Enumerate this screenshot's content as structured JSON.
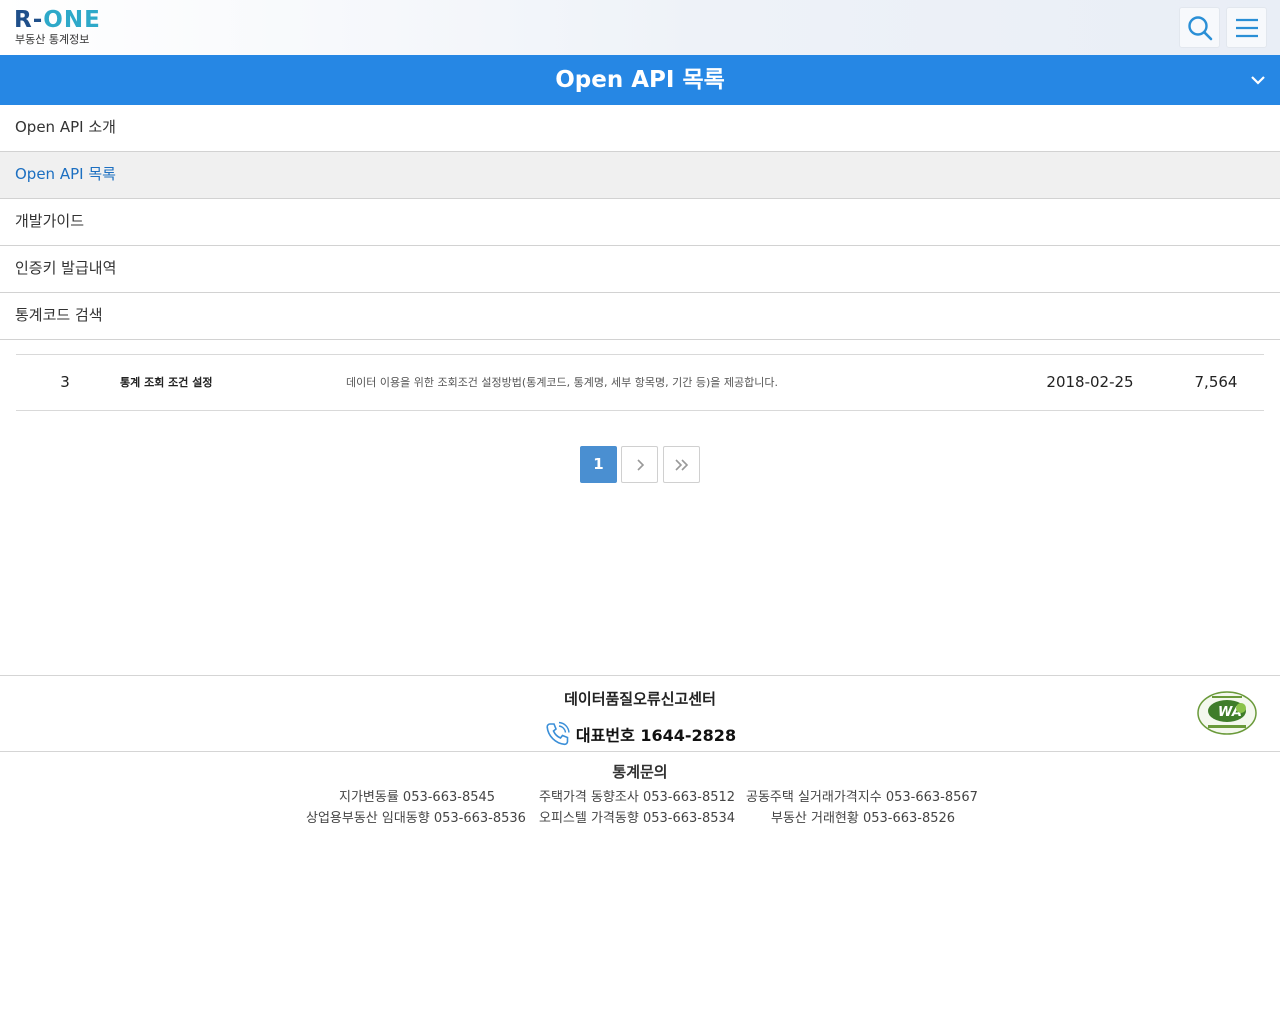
{
  "header": {
    "logo_r": "R-",
    "logo_one": "ONE",
    "logo_sub": "부동산 통계정보",
    "search_icon": "search-icon",
    "menu_icon": "hamburger-icon"
  },
  "titlebar": {
    "title": "Open API 목록"
  },
  "submenu": {
    "items": [
      {
        "label": "Open API 소개",
        "active": false
      },
      {
        "label": "Open API 목록",
        "active": true
      },
      {
        "label": "개발가이드",
        "active": false
      },
      {
        "label": "인증키 발급내역",
        "active": false
      },
      {
        "label": "통계코드 검색",
        "active": false
      }
    ]
  },
  "table": {
    "rows": [
      {
        "no": "3",
        "name": "통계 조회 조건 설정",
        "desc": "데이터 이용을 위한 조회조건 설정방법(통계코드, 통계명, 세부 항목명, 기간 등)을 제공합니다.",
        "date": "2018-02-25",
        "count": "7,564"
      }
    ]
  },
  "pagination": {
    "current": "1"
  },
  "footer": {
    "report_title": "데이터품질오류신고센터",
    "phone_label": "대표번호 1644-2828",
    "stat_title": "통계문의",
    "contacts": [
      "지가변동률 053-663-8545",
      "주택가격 동향조사 053-663-8512",
      "공동주택 실거래가격지수 053-663-8567",
      "상업용부동산 임대동향 053-663-8536",
      "오피스텔 가격동향 053-663-8534",
      "부동산 거래현황 053-663-8526"
    ]
  },
  "colors": {
    "primary": "#2687e4",
    "active_text": "#1c6fc1",
    "page_current": "#4a8fd1"
  }
}
